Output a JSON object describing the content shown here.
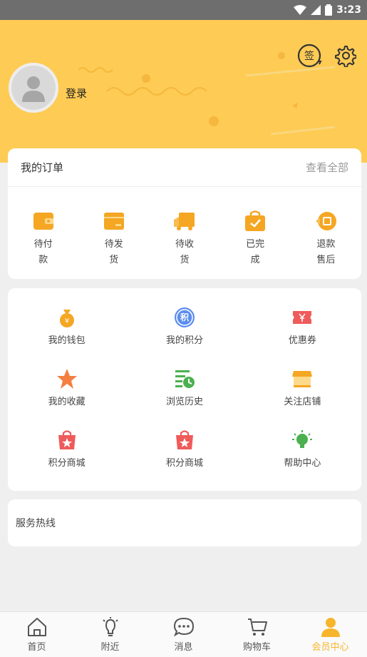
{
  "status_bar": {
    "time": "3:23"
  },
  "header": {
    "login_label": "登录",
    "sign_icon_text": "签"
  },
  "orders": {
    "title": "我的订单",
    "view_all": "查看全部",
    "items": [
      {
        "label": "待付款",
        "icon": "wallet-icon"
      },
      {
        "label": "待发货",
        "icon": "package-icon"
      },
      {
        "label": "待收货",
        "icon": "truck-icon"
      },
      {
        "label": "已完成",
        "icon": "completed-bag-icon"
      },
      {
        "label": "退款售后",
        "icon": "refund-icon"
      }
    ]
  },
  "features": [
    {
      "label": "我的钱包",
      "icon": "money-bag-icon"
    },
    {
      "label": "我的积分",
      "icon": "points-icon",
      "icon_text": "积"
    },
    {
      "label": "优惠券",
      "icon": "coupon-icon"
    },
    {
      "label": "我的收藏",
      "icon": "star-icon"
    },
    {
      "label": "浏览历史",
      "icon": "history-icon"
    },
    {
      "label": "关注店铺",
      "icon": "store-icon"
    },
    {
      "label": "积分商城",
      "icon": "shopping-bag-icon"
    },
    {
      "label": "积分商城",
      "icon": "shopping-bag-icon"
    },
    {
      "label": "帮助中心",
      "icon": "lightbulb-icon"
    }
  ],
  "service": {
    "label": "服务热线"
  },
  "tabs": [
    {
      "label": "首页",
      "icon": "home-icon"
    },
    {
      "label": "附近",
      "icon": "bulb-icon"
    },
    {
      "label": "消息",
      "icon": "message-icon"
    },
    {
      "label": "购物车",
      "icon": "cart-icon"
    },
    {
      "label": "会员中心",
      "icon": "user-icon",
      "active": true
    }
  ],
  "colors": {
    "accent": "#fecb54",
    "orange": "#f5a623",
    "active_tab": "#f7b52c"
  }
}
